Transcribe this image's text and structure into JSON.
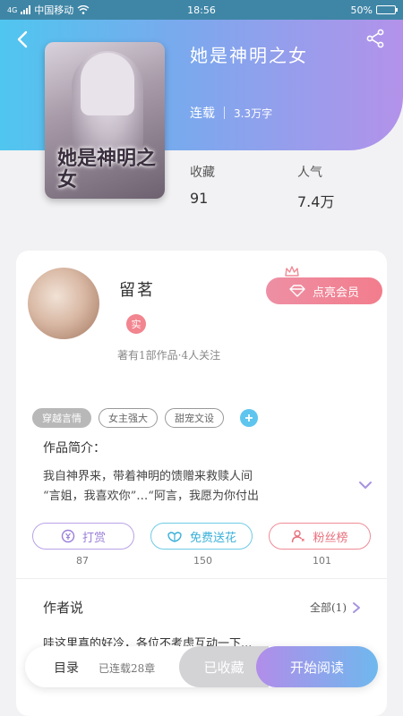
{
  "status_bar": {
    "network": "4G",
    "carrier": "中国移动",
    "time": "18:56",
    "battery": "50%",
    "battery_level": 0.5
  },
  "book": {
    "title": "她是神明之女",
    "status": "连载",
    "word_count": "3.3万字",
    "cover_title": "她是神明之女",
    "stats": [
      {
        "label": "收藏",
        "value": "91"
      },
      {
        "label": "人气",
        "value": "7.4万"
      }
    ]
  },
  "author": {
    "name": "留茗",
    "badge": "实",
    "meta": "著有1部作品·4人关注",
    "vip_label": "点亮会员"
  },
  "tags": [
    "穿越言情",
    "女主强大",
    "甜宠文设"
  ],
  "intro": {
    "title": "作品简介：",
    "lines": [
      "我自神界来，带着神明的馈赠来救赎人间",
      "“言姐，我喜欢你”…“阿言，我愿为你付出"
    ]
  },
  "actions": [
    {
      "label": "打赏",
      "count": "87"
    },
    {
      "label": "免费送花",
      "count": "150"
    },
    {
      "label": "粉丝榜",
      "count": "101"
    }
  ],
  "author_says": {
    "title": "作者说",
    "all_label": "全部(1)",
    "comment": "哇这里真的好冷，各位不考虑互动一下..."
  },
  "bottom_bar": {
    "toc": "目录",
    "updated": "已连载28章",
    "collected": "已收藏",
    "read": "开始阅读"
  },
  "colors": {
    "header_start": "#4fc6ef",
    "header_end": "#b392ea",
    "vip": "#f27d8c",
    "reward": "#9a7fd8",
    "flower": "#39b0d8",
    "fans": "#e8707c"
  }
}
